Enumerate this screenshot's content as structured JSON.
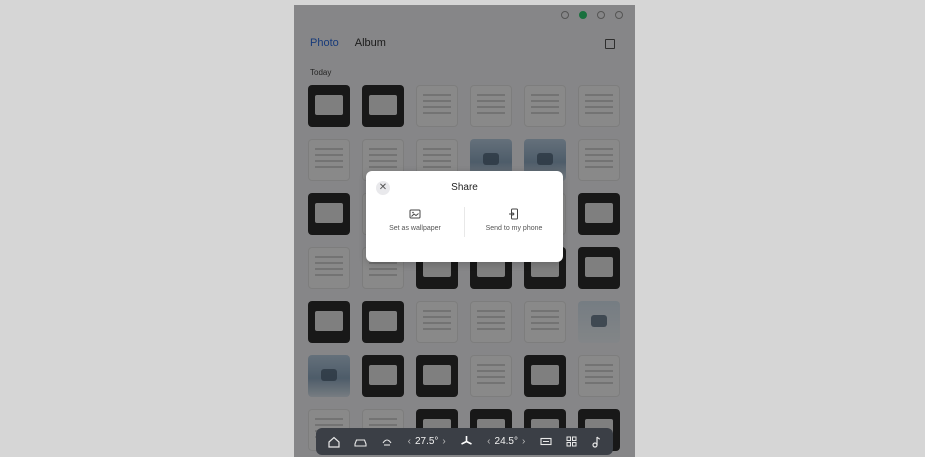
{
  "tabs": {
    "photo": "Photo",
    "album": "Album"
  },
  "section_label": "Today",
  "dialog": {
    "title": "Share",
    "close_glyph": "✕",
    "options": [
      {
        "label": "Set as wallpaper",
        "icon": "image-icon"
      },
      {
        "label": "Send to my phone",
        "icon": "send-to-phone-icon"
      }
    ]
  },
  "dock": {
    "left_temp": "27.5°",
    "right_temp": "24.5°",
    "chevron_left": "‹",
    "chevron_right": "›",
    "icons": [
      "home-icon",
      "car-icon",
      "seat-heat-icon",
      "fan-icon",
      "defrost-icon",
      "apps-icon",
      "music-icon"
    ]
  },
  "thumbnails": [
    "dark",
    "dark",
    "light",
    "light",
    "light",
    "light",
    "light",
    "light",
    "light",
    "blue",
    "blue",
    "light",
    "dark",
    "light",
    "light",
    "light",
    "light",
    "dark",
    "light",
    "light",
    "dark",
    "dark",
    "dark",
    "dark",
    "dark",
    "dark",
    "light",
    "light",
    "light",
    "sky",
    "blue",
    "dark",
    "dark",
    "light",
    "dark",
    "light",
    "light",
    "light",
    "dark",
    "dark",
    "dark",
    "dark"
  ]
}
